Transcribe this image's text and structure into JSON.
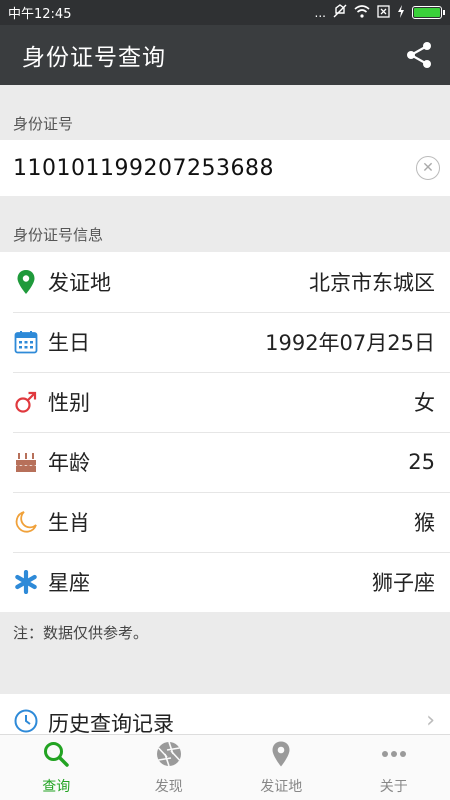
{
  "status_bar": {
    "time": "中午12:45",
    "dots": "...",
    "battery_level": 1.0
  },
  "app_bar": {
    "title": "身份证号查询"
  },
  "id_section": {
    "label": "身份证号",
    "value": "110101199207253688"
  },
  "info_section": {
    "label": "身份证号信息",
    "rows": [
      {
        "label": "发证地",
        "value": "北京市东城区",
        "icon": "location-pin-icon"
      },
      {
        "label": "生日",
        "value": "1992年07月25日",
        "icon": "calendar-icon"
      },
      {
        "label": "性别",
        "value": "女",
        "icon": "gender-icon"
      },
      {
        "label": "年龄",
        "value": "25",
        "icon": "cake-icon"
      },
      {
        "label": "生肖",
        "value": "猴",
        "icon": "moon-icon"
      },
      {
        "label": "星座",
        "value": "狮子座",
        "icon": "star-icon"
      }
    ]
  },
  "note": "注：数据仅供参考。",
  "history": {
    "label": "历史查询记录"
  },
  "tabs": [
    {
      "label": "查询",
      "icon": "search-icon",
      "active": true
    },
    {
      "label": "发现",
      "icon": "aperture-icon",
      "active": false
    },
    {
      "label": "发证地",
      "icon": "location-pin-icon",
      "active": false
    },
    {
      "label": "关于",
      "icon": "more-dots-icon",
      "active": false
    }
  ],
  "colors": {
    "accent": "#22a322",
    "app_bar": "#3a3d3f",
    "status_bar": "#2f3133",
    "background": "#ebebeb"
  }
}
